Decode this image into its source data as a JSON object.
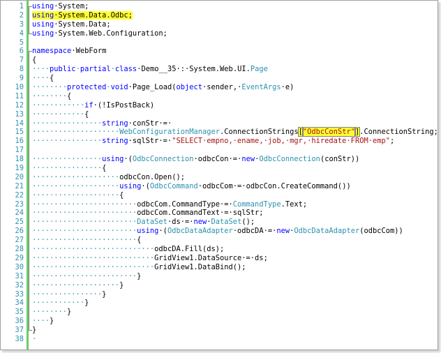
{
  "editor": {
    "lines": [
      {
        "n": "1",
        "segs": [
          {
            "t": "using",
            "c": "kw"
          },
          {
            "t": "·System;"
          }
        ]
      },
      {
        "n": "2",
        "segs": [
          {
            "t": "using",
            "c": "kw hl-yellow"
          },
          {
            "t": "·System.Data.Odbc;",
            "c": "hl-yellow"
          }
        ]
      },
      {
        "n": "3",
        "segs": [
          {
            "t": "using",
            "c": "kw"
          },
          {
            "t": "·System.Data;"
          }
        ]
      },
      {
        "n": "4",
        "segs": [
          {
            "t": "using",
            "c": "kw"
          },
          {
            "t": "·System.Web.Configuration;"
          }
        ]
      },
      {
        "n": "5",
        "segs": []
      },
      {
        "n": "6",
        "segs": [
          {
            "t": "namespace",
            "c": "kw"
          },
          {
            "t": "·WebForm"
          }
        ]
      },
      {
        "n": "7",
        "segs": [
          {
            "t": "{"
          }
        ]
      },
      {
        "n": "8",
        "segs": [
          {
            "t": "····",
            "c": "ws"
          },
          {
            "t": "public",
            "c": "kw"
          },
          {
            "t": "·",
            "c": "ws"
          },
          {
            "t": "partial",
            "c": "kw"
          },
          {
            "t": "·",
            "c": "ws"
          },
          {
            "t": "class",
            "c": "kw"
          },
          {
            "t": "·Demo__35·:·System.Web.UI."
          },
          {
            "t": "Page",
            "c": "ty"
          }
        ]
      },
      {
        "n": "9",
        "segs": [
          {
            "t": "····",
            "c": "ws"
          },
          {
            "t": "{"
          }
        ]
      },
      {
        "n": "10",
        "segs": [
          {
            "t": "········",
            "c": "ws"
          },
          {
            "t": "protected",
            "c": "kw"
          },
          {
            "t": "·",
            "c": "ws"
          },
          {
            "t": "void",
            "c": "kw"
          },
          {
            "t": "·Page_Load("
          },
          {
            "t": "object",
            "c": "kw"
          },
          {
            "t": "·sender,·"
          },
          {
            "t": "EventArgs",
            "c": "ty"
          },
          {
            "t": "·e)"
          }
        ]
      },
      {
        "n": "11",
        "segs": [
          {
            "t": "········",
            "c": "ws"
          },
          {
            "t": "{"
          }
        ]
      },
      {
        "n": "12",
        "segs": [
          {
            "t": "············",
            "c": "ws"
          },
          {
            "t": "if",
            "c": "kw"
          },
          {
            "t": "·(!IsPostBack)"
          }
        ]
      },
      {
        "n": "13",
        "segs": [
          {
            "t": "············",
            "c": "ws"
          },
          {
            "t": "{"
          }
        ]
      },
      {
        "n": "14",
        "segs": [
          {
            "t": "················",
            "c": "ws"
          },
          {
            "t": "string",
            "c": "kw"
          },
          {
            "t": "·conStr·=·"
          }
        ]
      },
      {
        "n": "15",
        "segs": [
          {
            "t": "····················",
            "c": "ws"
          },
          {
            "t": "WebConfigurationManager",
            "c": "ty"
          },
          {
            "t": ".ConnectionStrings"
          },
          {
            "t": "[",
            "c": "hl-box"
          },
          {
            "t": "\"OdbcConStr\"",
            "c": "st hl-box"
          },
          {
            "t": "]",
            "c": "hl-box"
          },
          {
            "t": ".ConnectionString;"
          }
        ]
      },
      {
        "n": "16",
        "segs": [
          {
            "t": "················",
            "c": "ws"
          },
          {
            "t": "string",
            "c": "kw"
          },
          {
            "t": "·sqlStr·=·"
          },
          {
            "t": "\"SELECT·empno,·ename,·job,·mgr,·hiredate·FROM·emp\"",
            "c": "st"
          },
          {
            "t": ";"
          }
        ]
      },
      {
        "n": "17",
        "segs": []
      },
      {
        "n": "18",
        "segs": [
          {
            "t": "················",
            "c": "ws"
          },
          {
            "t": "using",
            "c": "kw"
          },
          {
            "t": "·("
          },
          {
            "t": "OdbcConnection",
            "c": "ty"
          },
          {
            "t": "·odbcCon·=·"
          },
          {
            "t": "new",
            "c": "kw"
          },
          {
            "t": "·"
          },
          {
            "t": "OdbcConnection",
            "c": "ty"
          },
          {
            "t": "(conStr))"
          }
        ]
      },
      {
        "n": "19",
        "segs": [
          {
            "t": "················",
            "c": "ws"
          },
          {
            "t": "{"
          }
        ]
      },
      {
        "n": "20",
        "segs": [
          {
            "t": "····················",
            "c": "ws"
          },
          {
            "t": "odbcCon.Open();"
          }
        ]
      },
      {
        "n": "21",
        "segs": [
          {
            "t": "····················",
            "c": "ws"
          },
          {
            "t": "using",
            "c": "kw"
          },
          {
            "t": "·("
          },
          {
            "t": "OdbcCommand",
            "c": "ty"
          },
          {
            "t": "·odbcCom·=·odbcCon.CreateCommand())"
          }
        ]
      },
      {
        "n": "22",
        "segs": [
          {
            "t": "····················",
            "c": "ws"
          },
          {
            "t": "{"
          }
        ]
      },
      {
        "n": "23",
        "segs": [
          {
            "t": "························",
            "c": "ws"
          },
          {
            "t": "odbcCom.CommandType·=·"
          },
          {
            "t": "CommandType",
            "c": "ty"
          },
          {
            "t": ".Text;"
          }
        ]
      },
      {
        "n": "24",
        "segs": [
          {
            "t": "························",
            "c": "ws"
          },
          {
            "t": "odbcCom.CommandText·=·sqlStr;"
          }
        ]
      },
      {
        "n": "25",
        "segs": [
          {
            "t": "························",
            "c": "ws"
          },
          {
            "t": "DataSet",
            "c": "ty"
          },
          {
            "t": "·ds·=·"
          },
          {
            "t": "new",
            "c": "kw"
          },
          {
            "t": "·"
          },
          {
            "t": "DataSet",
            "c": "ty"
          },
          {
            "t": "();"
          }
        ]
      },
      {
        "n": "26",
        "segs": [
          {
            "t": "························",
            "c": "ws"
          },
          {
            "t": "using",
            "c": "kw"
          },
          {
            "t": "·("
          },
          {
            "t": "OdbcDataAdapter",
            "c": "ty"
          },
          {
            "t": "·odbcDA·=·"
          },
          {
            "t": "new",
            "c": "kw"
          },
          {
            "t": "·"
          },
          {
            "t": "OdbcDataAdapter",
            "c": "ty"
          },
          {
            "t": "(odbcCom))"
          }
        ]
      },
      {
        "n": "27",
        "segs": [
          {
            "t": "························",
            "c": "ws"
          },
          {
            "t": "{"
          }
        ]
      },
      {
        "n": "28",
        "segs": [
          {
            "t": "····························",
            "c": "ws"
          },
          {
            "t": "odbcDA.Fill(ds);"
          }
        ]
      },
      {
        "n": "29",
        "segs": [
          {
            "t": "····························",
            "c": "ws"
          },
          {
            "t": "GridView1.DataSource·=·ds;"
          }
        ]
      },
      {
        "n": "30",
        "segs": [
          {
            "t": "····························",
            "c": "ws"
          },
          {
            "t": "GridView1.DataBind();"
          }
        ]
      },
      {
        "n": "31",
        "segs": [
          {
            "t": "························",
            "c": "ws"
          },
          {
            "t": "}"
          }
        ]
      },
      {
        "n": "32",
        "segs": [
          {
            "t": "····················",
            "c": "ws"
          },
          {
            "t": "}"
          }
        ]
      },
      {
        "n": "33",
        "segs": [
          {
            "t": "················",
            "c": "ws"
          },
          {
            "t": "}"
          }
        ]
      },
      {
        "n": "34",
        "segs": [
          {
            "t": "············",
            "c": "ws"
          },
          {
            "t": "}"
          }
        ]
      },
      {
        "n": "35",
        "segs": [
          {
            "t": "········",
            "c": "ws"
          },
          {
            "t": "}"
          }
        ]
      },
      {
        "n": "36",
        "segs": [
          {
            "t": "····",
            "c": "ws"
          },
          {
            "t": "}"
          }
        ]
      },
      {
        "n": "37",
        "segs": [
          {
            "t": "}"
          }
        ]
      },
      {
        "n": "38",
        "segs": [
          {
            "t": "·",
            "c": "ws"
          }
        ]
      }
    ]
  }
}
